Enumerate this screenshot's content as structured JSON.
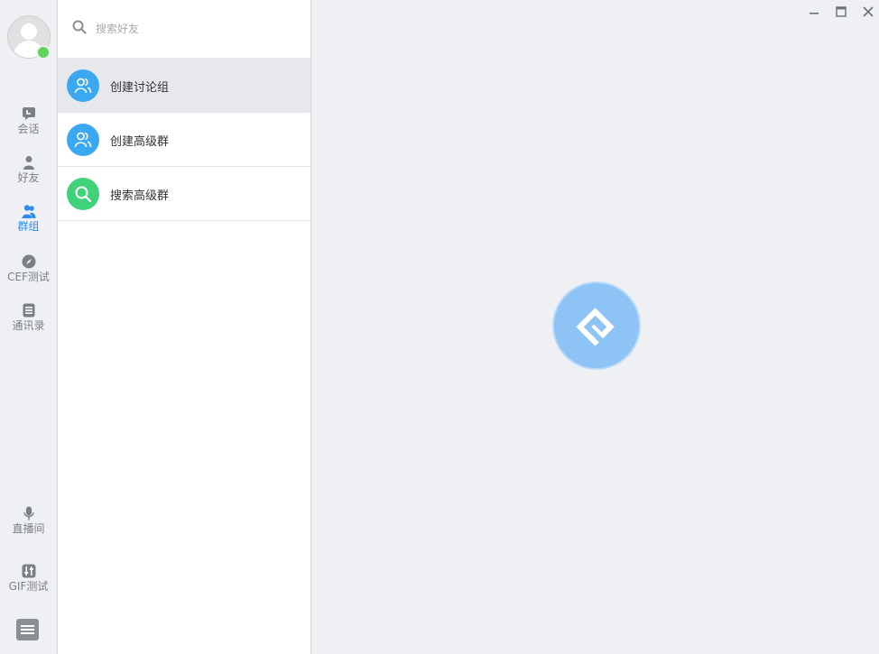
{
  "nav": {
    "items": [
      {
        "label": "会话",
        "icon": "chat-icon"
      },
      {
        "label": "好友",
        "icon": "user-icon"
      },
      {
        "label": "群组",
        "icon": "group-icon"
      },
      {
        "label": "CEF测试",
        "icon": "compass-icon"
      },
      {
        "label": "通讯录",
        "icon": "contacts-icon"
      }
    ],
    "bottom_items": [
      {
        "label": "直播间",
        "icon": "microphone-icon"
      },
      {
        "label": "GIF测试",
        "icon": "sliders-icon"
      }
    ],
    "active": "群组"
  },
  "search": {
    "placeholder": "搜索好友"
  },
  "list": [
    {
      "label": "创建讨论组",
      "color": "#3aa9f2",
      "icon": "group-icon"
    },
    {
      "label": "创建高级群",
      "color": "#3aa9f2",
      "icon": "group-icon"
    },
    {
      "label": "搜索高级群",
      "color": "#3fd27a",
      "icon": "search-icon"
    }
  ],
  "colors": {
    "accent": "#2e8cf0",
    "online": "#5fd35a",
    "logo": "#8ec3f5"
  }
}
